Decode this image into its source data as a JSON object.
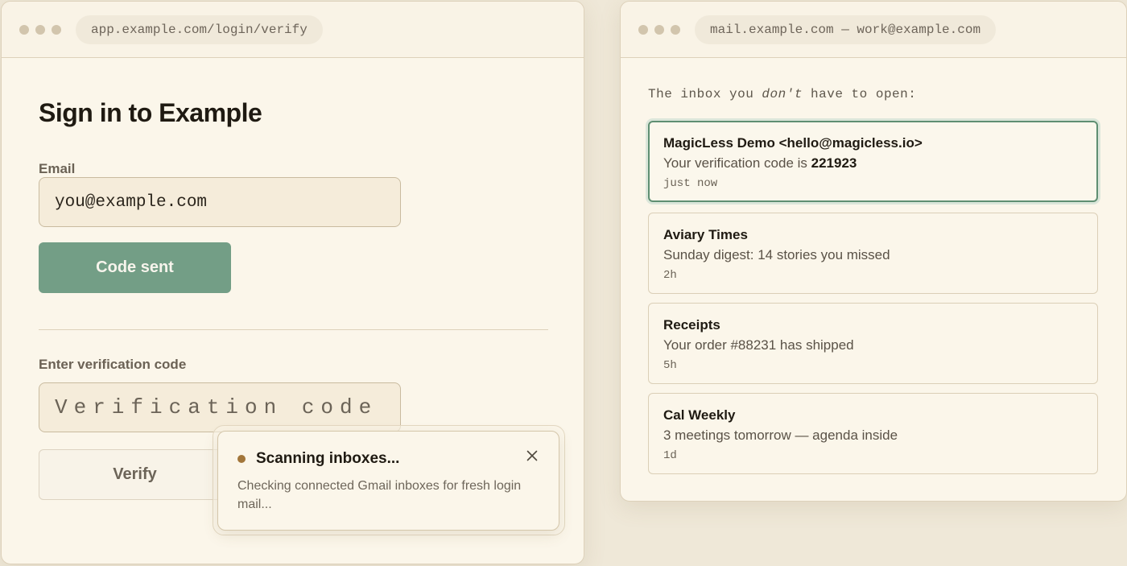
{
  "login_window": {
    "url": "app.example.com/login/verify",
    "title": "Sign in to Example",
    "email_label": "Email",
    "email_value": "you@example.com",
    "send_button_label": "Code sent",
    "code_label": "Enter verification code",
    "code_placeholder": "Verification code",
    "verify_button_label": "Verify"
  },
  "toast": {
    "title": "Scanning inboxes...",
    "body": "Checking connected Gmail inboxes for fresh login mail...",
    "close_icon": "close-icon"
  },
  "mail_window": {
    "url": "mail.example.com — work@example.com",
    "heading_before": "The inbox you ",
    "heading_emphasis": "don't",
    "heading_after": " have to open:",
    "messages": [
      {
        "from": "MagicLess Demo <hello@magicless.io>",
        "subject_prefix": "Your verification code is ",
        "subject_code": "221923",
        "time": "just now",
        "active": true
      },
      {
        "from": "Aviary Times",
        "subject": "Sunday digest: 14 stories you missed",
        "time": "2h"
      },
      {
        "from": "Receipts",
        "subject": "Your order #88231 has shipped",
        "time": "5h"
      },
      {
        "from": "Cal Weekly",
        "subject": "3 meetings tomorrow — agenda inside",
        "time": "1d"
      }
    ]
  },
  "colors": {
    "accent_green": "#739e86",
    "active_border": "#5f8f72",
    "status_dot": "#a2763a",
    "window_bg": "#fbf6ea"
  }
}
